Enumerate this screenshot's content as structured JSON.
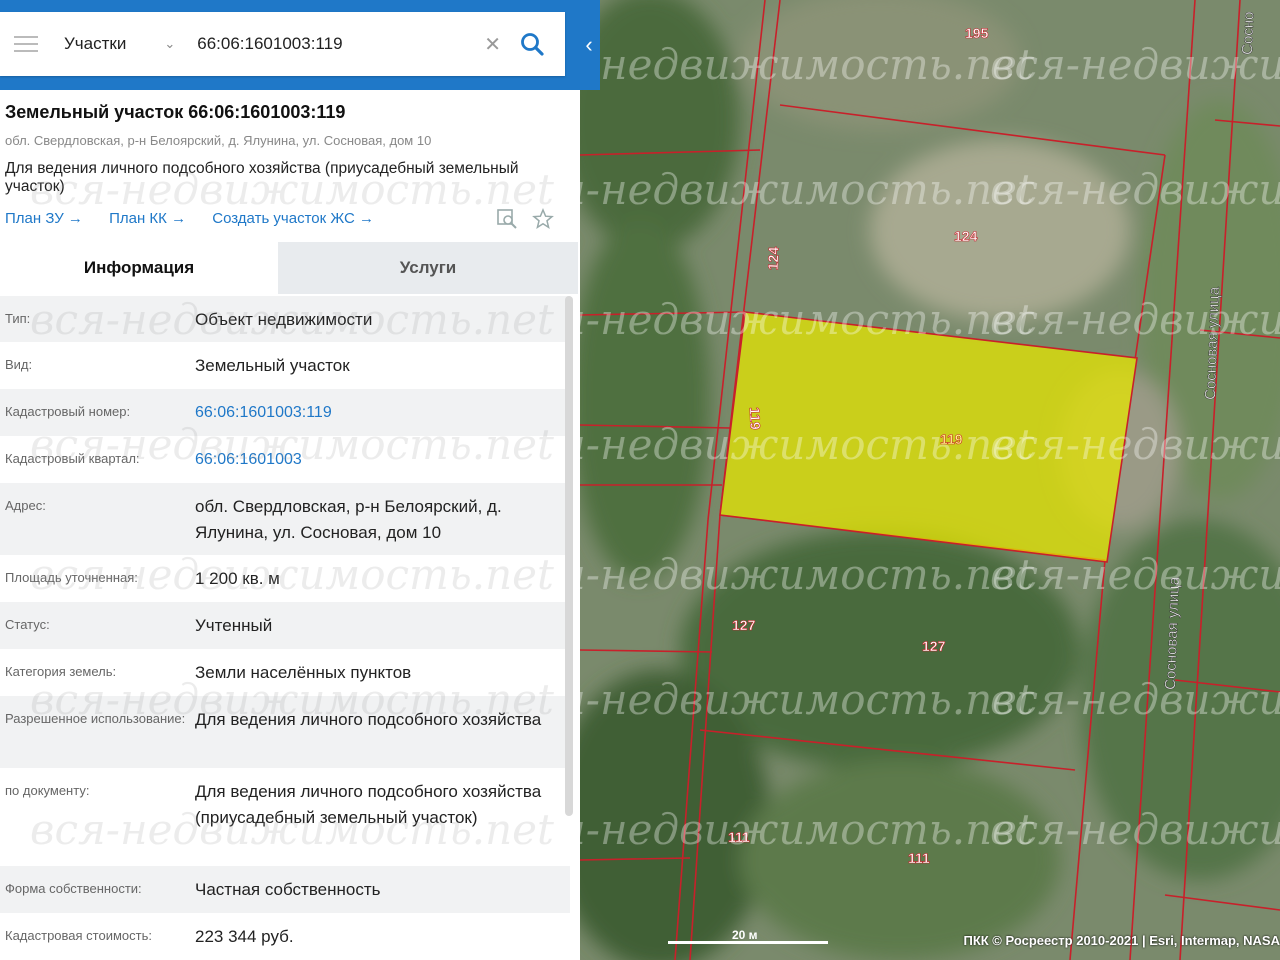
{
  "search": {
    "category": "Участки",
    "value": "66:06:1601003:119"
  },
  "parcel": {
    "title": "Земельный участок 66:06:1601003:119",
    "address": "обл. Свердловская, р-н Белоярский, д. Ялунина, ул. Сосновая, дом 10",
    "purpose": "Для ведения личного подсобного хозяйства (приусадебный земельный участок)",
    "links": [
      "План ЗУ →",
      "План КК →",
      "Создать участок ЖС →"
    ]
  },
  "tabs": {
    "info": "Информация",
    "services": "Услуги"
  },
  "rows": [
    {
      "label": "Тип:",
      "value": "Объект недвижимости"
    },
    {
      "label": "Вид:",
      "value": "Земельный участок"
    },
    {
      "label": "Кадастровый номер:",
      "value": "66:06:1601003:119"
    },
    {
      "label": "Кадастровый квартал:",
      "value": "66:06:1601003"
    },
    {
      "label": "Адрес:",
      "value": "обл. Свердловская, р-н Белоярский, д. Ялунина, ул. Сосновая, дом 10"
    },
    {
      "label": "Площадь уточненная:",
      "value": "1 200 кв. м"
    },
    {
      "label": "Статус:",
      "value": "Учтенный"
    },
    {
      "label": "Категория земель:",
      "value": "Земли населённых пунктов"
    },
    {
      "label": "Разрешенное использование:",
      "value": "Для ведения личного подсобного хозяйства"
    },
    {
      "label": "по документу:",
      "value": "Для ведения личного подсобного хозяйства (приусадебный земельный участок)"
    },
    {
      "label": "Форма собственности:",
      "value": "Частная собственность"
    },
    {
      "label": "Кадастровая стоимость:",
      "value": "223 344 руб."
    }
  ],
  "map": {
    "labels": {
      "l195": "195",
      "l124a": "124",
      "l124b": "124",
      "l119a": "119",
      "l119b": "119",
      "l127a": "127",
      "l127b": "127",
      "l111a": "111",
      "l111b": "111"
    },
    "streets": {
      "s1": "Сосновая улица",
      "s2": "Сосновая улица",
      "s3": "Сосно"
    },
    "scale": "20 м",
    "credits": "ПКК © Росреестр 2010-2021 | Esri, Intermap, NASA"
  },
  "watermark": "вся-недвижимость.net",
  "colors": {
    "accent": "#1f78c8",
    "selected": "#e6e600",
    "boundary": "#c8202a"
  }
}
